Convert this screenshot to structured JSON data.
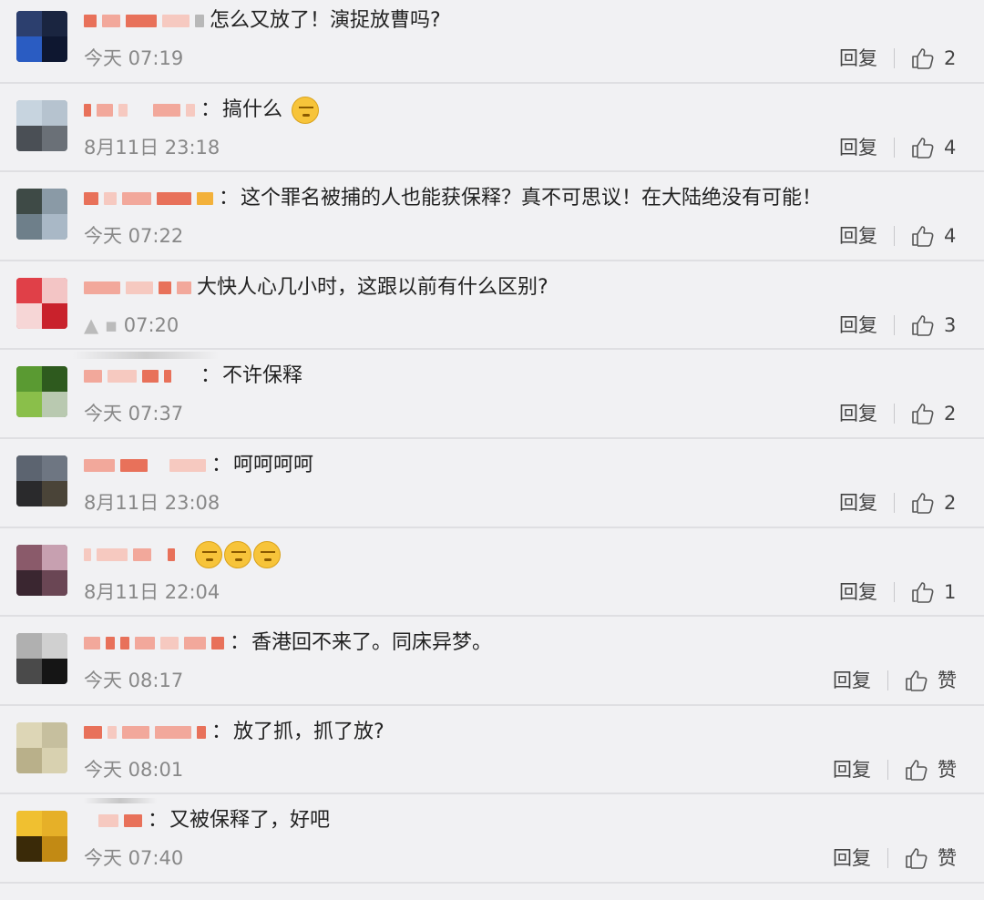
{
  "comments": [
    {
      "text": "怎么又放了！演捉放曹吗?",
      "time": "今天 07:19",
      "reply": "回复",
      "likes": "2",
      "emoji_count": 0
    },
    {
      "text": "搞什么",
      "time": "8月11日 23:18",
      "reply": "回复",
      "likes": "4",
      "emoji_count": 1
    },
    {
      "text": "这个罪名被捕的人也能获保释？真不可思议！在大陆绝没有可能！",
      "time": "今天 07:22",
      "reply": "回复",
      "likes": "4",
      "emoji_count": 0
    },
    {
      "text": "大快人心几小时，这跟以前有什么区别?",
      "time": "07:20",
      "reply": "回复",
      "likes": "3",
      "emoji_count": 0
    },
    {
      "text": "不许保释",
      "time": "今天 07:37",
      "reply": "回复",
      "likes": "2",
      "emoji_count": 0
    },
    {
      "text": "呵呵呵呵",
      "time": "8月11日 23:08",
      "reply": "回复",
      "likes": "2",
      "emoji_count": 0
    },
    {
      "text": "",
      "time": "8月11日 22:04",
      "reply": "回复",
      "likes": "1",
      "emoji_count": 3
    },
    {
      "text": "香港回不来了。同床异梦。",
      "time": "今天 08:17",
      "reply": "回复",
      "likes": "赞",
      "emoji_count": 0
    },
    {
      "text": "放了抓，抓了放?",
      "time": "今天 08:01",
      "reply": "回复",
      "likes": "赞",
      "emoji_count": 0
    },
    {
      "text": "又被保释了，好吧",
      "time": "今天 07:40",
      "reply": "回复",
      "likes": "赞",
      "emoji_count": 0
    }
  ],
  "name_colors": [
    "#e8715a",
    "#f2a89b",
    "#f6c9c0"
  ],
  "icons": {
    "like": "thumbs-up-icon",
    "emoji": "face-emoji-icon"
  }
}
